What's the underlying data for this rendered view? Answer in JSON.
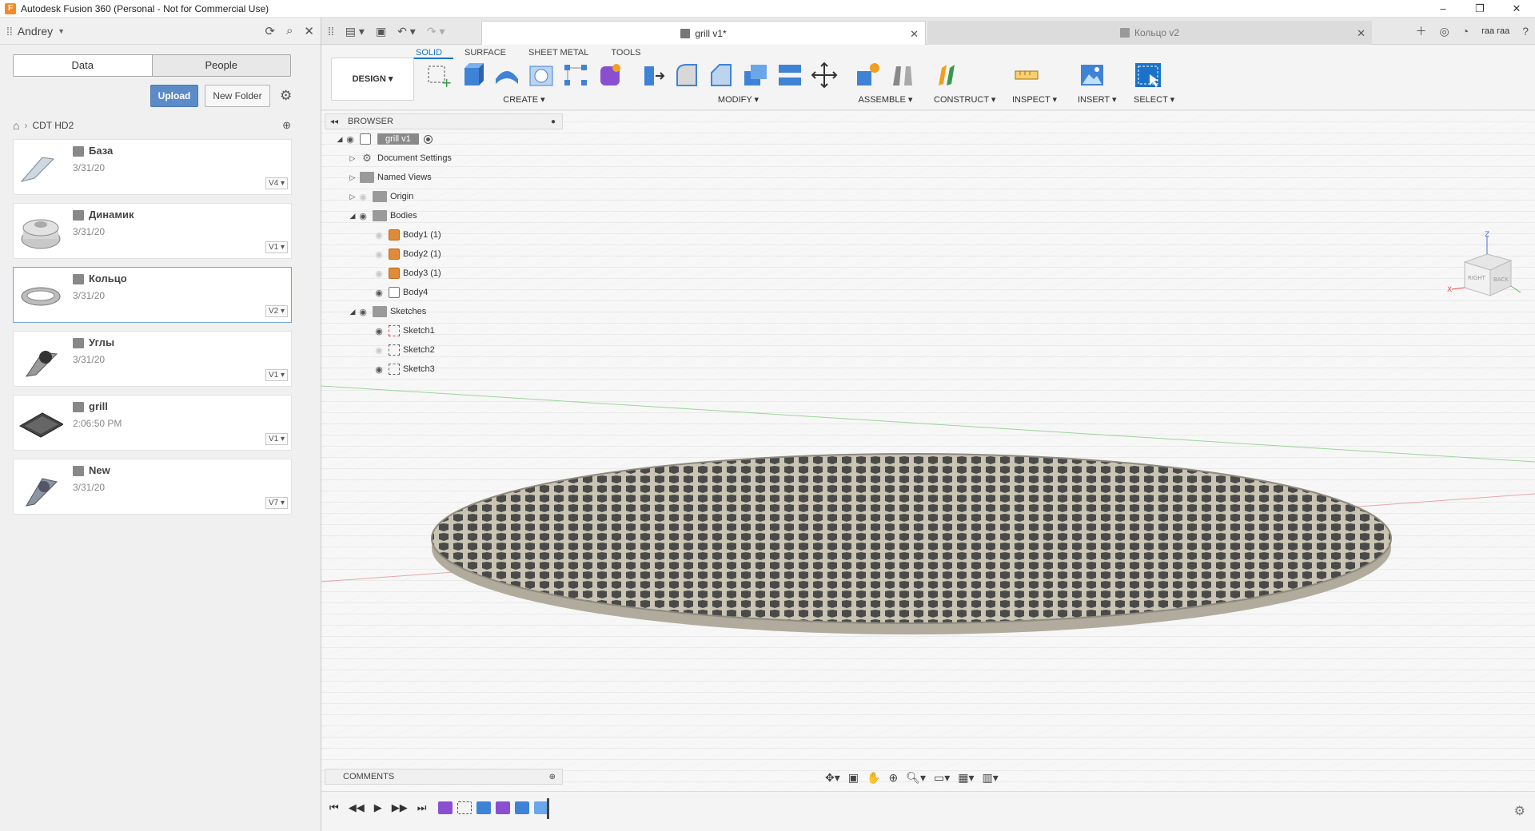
{
  "window": {
    "title": "Autodesk Fusion 360 (Personal - Not for Commercial Use)",
    "controls": [
      "–",
      "❐",
      "✕"
    ]
  },
  "data_panel": {
    "user": "Andrey",
    "tabs": [
      "Data",
      "People"
    ],
    "upload_label": "Upload",
    "new_folder_label": "New Folder",
    "breadcrumb": "CDT HD2",
    "files": [
      {
        "name": "База",
        "date": "3/31/20",
        "version": "V4"
      },
      {
        "name": "Динамик",
        "date": "3/31/20",
        "version": "V1"
      },
      {
        "name": "Кольцо",
        "date": "3/31/20",
        "version": "V2"
      },
      {
        "name": "Углы",
        "date": "3/31/20",
        "version": "V1"
      },
      {
        "name": "grill",
        "date": "2:06:50 PM",
        "version": "V1"
      },
      {
        "name": "New",
        "date": "3/31/20",
        "version": "V7"
      }
    ]
  },
  "tabs": {
    "active": "grill v1*",
    "inactive": "Кольцо v2",
    "user_short": "гаа гаа"
  },
  "toolbar": {
    "workspace": "DESIGN",
    "ribbon_tabs": [
      "SOLID",
      "SURFACE",
      "SHEET METAL",
      "TOOLS"
    ],
    "groups": {
      "create": "CREATE",
      "modify": "MODIFY",
      "assemble": "ASSEMBLE",
      "construct": "CONSTRUCT",
      "inspect": "INSPECT",
      "insert": "INSERT",
      "select": "SELECT"
    }
  },
  "browser": {
    "header": "BROWSER",
    "root": "grill v1",
    "items": {
      "doc_settings": "Document Settings",
      "named_views": "Named Views",
      "origin": "Origin",
      "bodies": "Bodies",
      "body1": "Body1 (1)",
      "body2": "Body2 (1)",
      "body3": "Body3 (1)",
      "body4": "Body4",
      "sketches": "Sketches",
      "sketch1": "Sketch1",
      "sketch2": "Sketch2",
      "sketch3": "Sketch3"
    }
  },
  "viewcube": {
    "right": "RIGHT",
    "back": "BACK",
    "z": "Z",
    "x": "X"
  },
  "comments": {
    "label": "COMMENTS"
  },
  "colors": {
    "accent": "#1a73c8",
    "upload": "#5b8cc8",
    "body": "#e08a3a",
    "mesh": "#c9c4b4"
  }
}
